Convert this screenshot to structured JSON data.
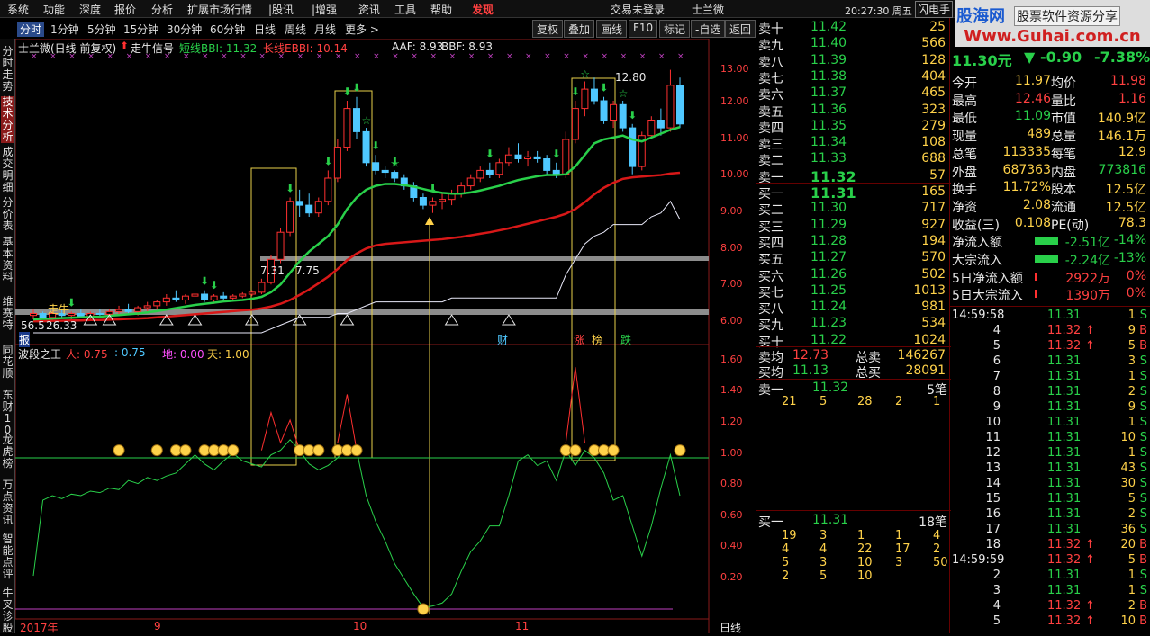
{
  "menubar": {
    "items": [
      "系统",
      "功能",
      "深度",
      "报价",
      "分析",
      "扩展市场行情",
      "|股讯",
      "|增强",
      "资讯",
      "工具",
      "帮助",
      "发现"
    ],
    "trade_status": "交易未登录",
    "stock_name": "士兰微",
    "time": "20:27:30 周五",
    "flash": "闪电手"
  },
  "watermark": {
    "site": "股海网",
    "slogan": "股票软件资源分享",
    "url": "Www.Guhai.com.cn"
  },
  "tabbar": {
    "periods": [
      "分时",
      "1分钟",
      "5分钟",
      "15分钟",
      "30分钟",
      "60分钟",
      "日线",
      "周线",
      "月线",
      "更多 >"
    ],
    "active_period": "分时",
    "buttons": [
      "复权",
      "叠加",
      "画线",
      "F10",
      "标记",
      "-自选",
      "返回"
    ]
  },
  "leftnav": [
    "分时走势",
    "技术分析",
    "成交明细",
    "分价表",
    "基本资料",
    "维赛特",
    "同花顺",
    "东财10",
    "龙虎榜",
    "万点资讯",
    "智能点评",
    "牛叉诊股"
  ],
  "main_chart": {
    "title": "士兰微(日线 前复权)",
    "signal_label": "走牛信号",
    "short_label": "短线BBI: 11.32",
    "long_label": "长线EBBI: 10.14",
    "aaf_label": "AAF: 8.93",
    "bbf_label": "BBF: 8.93",
    "price_ticks": [
      "13.00",
      "12.00",
      "11.00",
      "10.00",
      "9.00",
      "8.00",
      "7.00",
      "6.00"
    ],
    "high_label": "12.80",
    "low_label_1": "7.31",
    "low_label_2": "7.75",
    "low_label_3": "26.33",
    "low_label_4": "56.5",
    "tag_zou_niu": "走牛",
    "tag_cai": "财",
    "tag_zhang": "涨",
    "tag_bang": "榜",
    "tag_die": "跌",
    "tag_bao": "报"
  },
  "sub_chart": {
    "title": "波段之王",
    "ren_label": "人: 0.75",
    "colon_label": ": 0.75",
    "di_label": "地: 0.00",
    "tian_label": "天: 1.00",
    "ticks": [
      "1.60",
      "1.40",
      "1.20",
      "1.00",
      "0.80",
      "0.60",
      "0.40",
      "0.20"
    ],
    "bottom_axis": [
      "2017年",
      "9",
      "10",
      "11"
    ],
    "period_label": "日线"
  },
  "chart_data": {
    "type": "candlestick",
    "title": "士兰微(日线 前复权)",
    "ylim": [
      5.8,
      13.3
    ],
    "candles": [
      [
        6.45,
        6.6,
        6.35,
        6.5
      ],
      [
        6.5,
        6.55,
        6.35,
        6.4
      ],
      [
        6.4,
        6.55,
        6.3,
        6.5
      ],
      [
        6.5,
        6.6,
        6.4,
        6.45
      ],
      [
        6.45,
        6.55,
        6.35,
        6.5
      ],
      [
        6.5,
        6.6,
        6.4,
        6.42
      ],
      [
        6.42,
        6.55,
        6.35,
        6.5
      ],
      [
        6.5,
        6.6,
        6.4,
        6.48
      ],
      [
        6.48,
        6.6,
        6.38,
        6.55
      ],
      [
        6.55,
        6.7,
        6.45,
        6.6
      ],
      [
        6.6,
        6.75,
        6.5,
        6.55
      ],
      [
        6.55,
        6.7,
        6.45,
        6.65
      ],
      [
        6.65,
        6.8,
        6.55,
        6.7
      ],
      [
        6.7,
        6.85,
        6.6,
        6.8
      ],
      [
        6.8,
        7.0,
        6.7,
        6.9
      ],
      [
        6.9,
        7.1,
        6.8,
        6.85
      ],
      [
        6.85,
        7.0,
        6.75,
        6.95
      ],
      [
        6.95,
        7.1,
        6.85,
        7.0
      ],
      [
        7.0,
        7.1,
        6.8,
        6.85
      ],
      [
        6.85,
        7.0,
        6.75,
        6.95
      ],
      [
        6.95,
        7.05,
        6.85,
        6.9
      ],
      [
        6.9,
        7.0,
        6.85,
        6.95
      ],
      [
        6.95,
        7.05,
        6.9,
        7.0
      ],
      [
        7.0,
        7.1,
        6.95,
        7.05
      ],
      [
        7.05,
        7.4,
        7.0,
        7.3
      ],
      [
        7.3,
        8.0,
        7.25,
        7.9
      ],
      [
        7.9,
        8.7,
        7.8,
        8.6
      ],
      [
        8.6,
        9.5,
        8.5,
        9.4
      ],
      [
        9.4,
        9.7,
        9.0,
        9.3
      ],
      [
        9.3,
        9.6,
        9.0,
        9.1
      ],
      [
        9.1,
        9.5,
        9.0,
        9.4
      ],
      [
        9.4,
        10.2,
        9.3,
        10.0
      ],
      [
        10.0,
        11.0,
        9.9,
        10.8
      ],
      [
        10.8,
        12.0,
        10.7,
        11.8
      ],
      [
        11.8,
        12.1,
        11.0,
        11.2
      ],
      [
        11.2,
        11.3,
        10.3,
        10.4
      ],
      [
        10.4,
        10.6,
        10.1,
        10.2
      ],
      [
        10.2,
        10.3,
        10.0,
        10.15
      ],
      [
        10.15,
        10.2,
        9.9,
        10.0
      ],
      [
        10.0,
        10.1,
        9.7,
        9.8
      ],
      [
        9.8,
        9.9,
        9.4,
        9.5
      ],
      [
        9.5,
        9.6,
        9.2,
        9.3
      ],
      [
        9.3,
        9.5,
        9.1,
        9.4
      ],
      [
        9.4,
        9.6,
        9.2,
        9.45
      ],
      [
        9.45,
        9.7,
        9.3,
        9.6
      ],
      [
        9.6,
        9.9,
        9.5,
        9.8
      ],
      [
        9.8,
        10.1,
        9.7,
        10.0
      ],
      [
        10.0,
        10.3,
        9.9,
        10.2
      ],
      [
        10.2,
        10.4,
        10.0,
        10.1
      ],
      [
        10.1,
        10.5,
        10.0,
        10.4
      ],
      [
        10.4,
        10.8,
        10.3,
        10.6
      ],
      [
        10.6,
        10.9,
        10.4,
        10.5
      ],
      [
        10.5,
        10.7,
        10.3,
        10.55
      ],
      [
        10.55,
        10.7,
        10.4,
        10.5
      ],
      [
        10.5,
        10.6,
        10.1,
        10.2
      ],
      [
        10.2,
        10.4,
        10.0,
        10.1
      ],
      [
        10.1,
        11.2,
        10.0,
        11.0
      ],
      [
        11.0,
        12.0,
        10.9,
        11.8
      ],
      [
        11.8,
        12.5,
        11.6,
        12.3
      ],
      [
        12.3,
        12.6,
        11.9,
        12.0
      ],
      [
        12.0,
        12.1,
        11.4,
        11.5
      ],
      [
        11.5,
        12.0,
        11.3,
        11.9
      ],
      [
        11.9,
        12.0,
        11.2,
        11.3
      ],
      [
        11.3,
        11.4,
        10.1,
        10.3
      ],
      [
        10.3,
        11.2,
        10.2,
        11.1
      ],
      [
        11.1,
        11.6,
        11.0,
        11.5
      ],
      [
        11.5,
        11.8,
        11.1,
        11.3
      ],
      [
        11.3,
        12.8,
        11.2,
        12.4
      ],
      [
        12.4,
        12.6,
        11.3,
        11.4
      ]
    ],
    "short_bbi": [
      6.35,
      6.36,
      6.37,
      6.38,
      6.39,
      6.4,
      6.41,
      6.42,
      6.44,
      6.46,
      6.48,
      6.5,
      6.53,
      6.56,
      6.6,
      6.64,
      6.68,
      6.72,
      6.75,
      6.78,
      6.81,
      6.83,
      6.85,
      6.88,
      6.93,
      7.05,
      7.25,
      7.55,
      7.85,
      8.1,
      8.3,
      8.5,
      8.8,
      9.2,
      9.5,
      9.7,
      9.8,
      9.85,
      9.85,
      9.82,
      9.78,
      9.72,
      9.66,
      9.62,
      9.6,
      9.6,
      9.63,
      9.68,
      9.74,
      9.8,
      9.88,
      9.95,
      10.0,
      10.05,
      10.08,
      10.08,
      10.1,
      10.3,
      10.6,
      10.9,
      11.0,
      11.05,
      11.1,
      11.0,
      10.95,
      11.05,
      11.15,
      11.25,
      11.32
    ],
    "long_ebbi": [
      6.3,
      6.3,
      6.31,
      6.31,
      6.32,
      6.32,
      6.33,
      6.33,
      6.34,
      6.35,
      6.36,
      6.37,
      6.38,
      6.4,
      6.42,
      6.44,
      6.46,
      6.48,
      6.5,
      6.52,
      6.54,
      6.56,
      6.58,
      6.6,
      6.63,
      6.68,
      6.75,
      6.85,
      6.98,
      7.12,
      7.28,
      7.45,
      7.65,
      7.88,
      8.05,
      8.18,
      8.26,
      8.3,
      8.32,
      8.34,
      8.36,
      8.38,
      8.4,
      8.42,
      8.45,
      8.48,
      8.52,
      8.56,
      8.6,
      8.65,
      8.7,
      8.76,
      8.82,
      8.88,
      8.94,
      9.0,
      9.08,
      9.2,
      9.38,
      9.58,
      9.75,
      9.88,
      9.98,
      10.02,
      10.04,
      10.06,
      10.08,
      10.12,
      10.14
    ],
    "aaf": [
      6.0,
      6.0,
      6.0,
      6.0,
      6.0,
      6.0,
      6.0,
      6.0,
      6.0,
      6.0,
      6.0,
      6.0,
      6.0,
      6.0,
      6.0,
      6.0,
      6.0,
      6.0,
      6.0,
      6.0,
      6.0,
      6.0,
      6.0,
      6.0,
      6.0,
      6.1,
      6.2,
      6.3,
      6.4,
      6.4,
      6.4,
      6.4,
      6.5,
      6.5,
      6.6,
      6.7,
      6.8,
      6.8,
      6.8,
      6.8,
      6.8,
      6.8,
      6.8,
      6.8,
      6.9,
      6.9,
      6.9,
      6.9,
      6.9,
      6.9,
      6.9,
      6.9,
      6.9,
      6.9,
      6.9,
      6.9,
      7.5,
      7.9,
      8.3,
      8.5,
      8.6,
      8.8,
      8.8,
      8.8,
      8.8,
      9.0,
      9.1,
      9.4,
      8.93
    ],
    "wave_king": [
      0.22,
      0.72,
      0.75,
      0.73,
      0.76,
      0.75,
      0.78,
      0.77,
      0.8,
      0.79,
      0.85,
      0.83,
      0.87,
      0.85,
      0.88,
      0.9,
      0.96,
      1.02,
      0.96,
      0.92,
      0.98,
      1.03,
      0.98,
      0.96,
      0.94,
      1.02,
      1.05,
      1.12,
      1.05,
      0.96,
      0.92,
      0.95,
      1.0,
      1.08,
      1.05,
      0.75,
      0.58,
      0.45,
      0.3,
      0.2,
      0.1,
      0.01,
      0.02,
      0.04,
      0.1,
      0.25,
      0.38,
      0.45,
      0.55,
      0.55,
      0.75,
      0.98,
      1.02,
      0.95,
      0.98,
      0.85,
      1.05,
      0.95,
      1.05,
      1.0,
      0.9,
      0.72,
      0.75,
      0.55,
      0.35,
      0.55,
      0.8,
      1.02,
      0.75
    ],
    "wave_king_red": [
      0,
      0,
      0,
      0,
      0,
      0,
      0,
      0,
      0,
      0,
      0,
      0,
      0,
      0,
      0,
      0,
      0,
      0,
      0,
      0,
      0,
      0,
      0,
      0,
      1.05,
      1.3,
      1.1,
      1.25,
      1.05,
      0,
      0,
      0,
      1.1,
      1.42,
      1.05,
      0,
      0,
      0,
      0,
      0,
      0,
      0,
      0,
      0,
      0,
      0,
      0,
      0,
      0,
      0,
      0,
      0,
      0,
      0,
      0,
      0,
      1.1,
      1.6,
      1.1,
      0,
      0,
      0,
      0,
      0,
      0,
      0,
      0,
      0,
      0
    ]
  },
  "orderbook": {
    "asks": [
      {
        "label": "卖十",
        "price": "11.42",
        "vol": "25"
      },
      {
        "label": "卖九",
        "price": "11.40",
        "vol": "566"
      },
      {
        "label": "卖八",
        "price": "11.39",
        "vol": "128"
      },
      {
        "label": "卖七",
        "price": "11.38",
        "vol": "404"
      },
      {
        "label": "卖六",
        "price": "11.37",
        "vol": "465"
      },
      {
        "label": "卖五",
        "price": "11.36",
        "vol": "323"
      },
      {
        "label": "卖四",
        "price": "11.35",
        "vol": "279"
      },
      {
        "label": "卖三",
        "price": "11.34",
        "vol": "108"
      },
      {
        "label": "卖二",
        "price": "11.33",
        "vol": "688"
      },
      {
        "label": "卖一",
        "price": "11.32",
        "vol": "57"
      }
    ],
    "bids": [
      {
        "label": "买一",
        "price": "11.31",
        "vol": "165"
      },
      {
        "label": "买二",
        "price": "11.30",
        "vol": "717"
      },
      {
        "label": "买三",
        "price": "11.29",
        "vol": "927"
      },
      {
        "label": "买四",
        "price": "11.28",
        "vol": "194"
      },
      {
        "label": "买五",
        "price": "11.27",
        "vol": "570"
      },
      {
        "label": "买六",
        "price": "11.26",
        "vol": "502"
      },
      {
        "label": "买七",
        "price": "11.25",
        "vol": "1013"
      },
      {
        "label": "买八",
        "price": "11.24",
        "vol": "981"
      },
      {
        "label": "买九",
        "price": "11.23",
        "vol": "534"
      },
      {
        "label": "买十",
        "price": "11.22",
        "vol": "1024"
      }
    ],
    "avg_ask_label": "卖均",
    "avg_ask": "12.73",
    "total_ask_label": "总卖",
    "total_ask": "146267",
    "avg_bid_label": "买均",
    "avg_bid": "11.13",
    "total_bid_label": "总买",
    "total_bid": "28091",
    "queue_ask_label": "卖一",
    "queue_ask_price": "11.32",
    "queue_ask_count": "5笔",
    "queue_ask_vols": [
      "21",
      "5",
      "28",
      "2",
      "1"
    ],
    "queue_bid_label": "买一",
    "queue_bid_price": "11.31",
    "queue_bid_count": "18笔",
    "queue_bid_vols": [
      [
        "19",
        "3",
        "1",
        "1",
        "4"
      ],
      [
        "4",
        "4",
        "22",
        "17",
        "2"
      ],
      [
        "5",
        "3",
        "10",
        "3",
        "50"
      ],
      [
        "2",
        "5",
        "10",
        "",
        ""
      ]
    ]
  },
  "quote": {
    "price": "11.30元",
    "change": "-0.90",
    "pct": "-7.38%",
    "rows": [
      [
        "今开",
        "11.97",
        "均价",
        "11.98"
      ],
      [
        "最高",
        "12.46",
        "量比",
        "1.16"
      ],
      [
        "最低",
        "11.09",
        "市值",
        "140.9亿"
      ],
      [
        "现量",
        "489",
        "总量",
        "146.1万"
      ],
      [
        "总笔",
        "113335",
        "每笔",
        "12.9"
      ],
      [
        "外盘",
        "687363",
        "内盘",
        "773816"
      ],
      [
        "换手",
        "11.72%",
        "股本",
        "12.5亿"
      ],
      [
        "净资",
        "2.08",
        "流通",
        "12.5亿"
      ],
      [
        "收益(三)",
        "0.108",
        "PE(动)",
        "78.3"
      ],
      [
        "净流入额",
        "-2.51亿",
        "-14%",
        ""
      ],
      [
        "大宗流入",
        "-2.24亿",
        "-13%",
        ""
      ],
      [
        "5日净流入额",
        "2922万",
        "0%",
        ""
      ],
      [
        "5日大宗流入",
        "1390万",
        "0%",
        ""
      ]
    ]
  },
  "ticks": [
    {
      "t": "14:59:58",
      "p": "11.31",
      "v": "1",
      "d": "S"
    },
    {
      "t": "4",
      "p": "11.32",
      "v": "9",
      "d": "B"
    },
    {
      "t": "5",
      "p": "11.32",
      "v": "5",
      "d": "B"
    },
    {
      "t": "6",
      "p": "11.31",
      "v": "3",
      "d": "S"
    },
    {
      "t": "7",
      "p": "11.31",
      "v": "1",
      "d": "S"
    },
    {
      "t": "8",
      "p": "11.31",
      "v": "2",
      "d": "S"
    },
    {
      "t": "9",
      "p": "11.31",
      "v": "9",
      "d": "S"
    },
    {
      "t": "10",
      "p": "11.31",
      "v": "1",
      "d": "S"
    },
    {
      "t": "11",
      "p": "11.31",
      "v": "10",
      "d": "S"
    },
    {
      "t": "12",
      "p": "11.31",
      "v": "1",
      "d": "S"
    },
    {
      "t": "13",
      "p": "11.31",
      "v": "43",
      "d": "S"
    },
    {
      "t": "14",
      "p": "11.31",
      "v": "30",
      "d": "S"
    },
    {
      "t": "15",
      "p": "11.31",
      "v": "5",
      "d": "S"
    },
    {
      "t": "16",
      "p": "11.31",
      "v": "2",
      "d": "S"
    },
    {
      "t": "17",
      "p": "11.31",
      "v": "36",
      "d": "S"
    },
    {
      "t": "18",
      "p": "11.32",
      "v": "20",
      "d": "B"
    },
    {
      "t": "14:59:59",
      "p": "11.32",
      "v": "5",
      "d": "B"
    },
    {
      "t": "2",
      "p": "11.31",
      "v": "1",
      "d": "S"
    },
    {
      "t": "3",
      "p": "11.31",
      "v": "1",
      "d": "S"
    },
    {
      "t": "4",
      "p": "11.32",
      "v": "2",
      "d": "B"
    },
    {
      "t": "5",
      "p": "11.32",
      "v": "10",
      "d": "B"
    }
  ]
}
